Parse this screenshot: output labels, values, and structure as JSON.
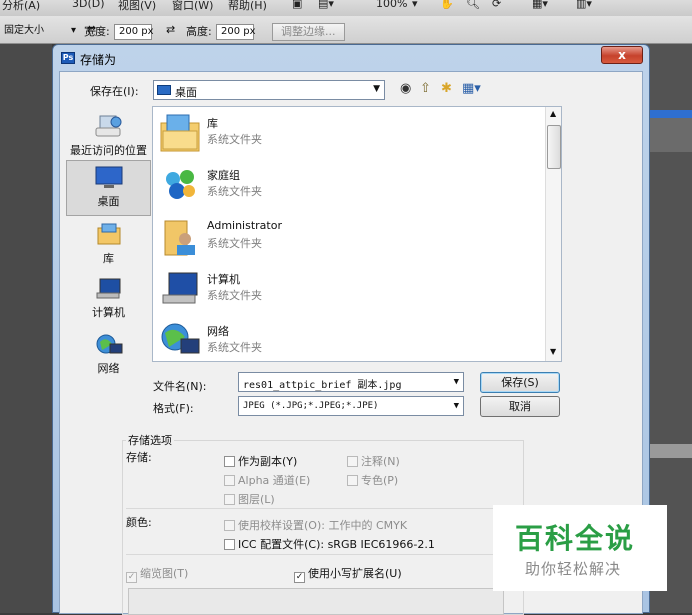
{
  "app": {
    "menus": [
      "分析(A)",
      "3D(D)",
      "视图(V)",
      "窗口(W)",
      "帮助(H)"
    ],
    "zoom": "100%",
    "options": {
      "style_value": "固定大小",
      "width_label": "宽度:",
      "width_value": "200 px",
      "height_label": "高度:",
      "height_value": "200 px",
      "refine_edge_button": "调整边缘..."
    }
  },
  "dialog": {
    "title": "存储为",
    "app_icon": "Ps",
    "close_glyph": "x",
    "save_in_label": "保存在(I):",
    "save_in_value": "桌面",
    "places": [
      {
        "label": "最近访问的位置",
        "icon": "recent-places-icon"
      },
      {
        "label": "桌面",
        "icon": "desktop-icon",
        "selected": true
      },
      {
        "label": "库",
        "icon": "libraries-icon"
      },
      {
        "label": "计算机",
        "icon": "computer-icon"
      },
      {
        "label": "网络",
        "icon": "network-icon"
      }
    ],
    "files": [
      {
        "name": "库",
        "type": "系统文件夹",
        "icon": "libraries-folder-icon"
      },
      {
        "name": "家庭组",
        "type": "系统文件夹",
        "icon": "homegroup-icon"
      },
      {
        "name": "Administrator",
        "type": "系统文件夹",
        "icon": "user-folder-icon"
      },
      {
        "name": "计算机",
        "type": "系统文件夹",
        "icon": "computer-icon"
      },
      {
        "name": "网络",
        "type": "系统文件夹",
        "icon": "network-icon"
      }
    ],
    "filename_label": "文件名(N):",
    "filename_value": "res01_attpic_brief 副本.jpg",
    "format_label": "格式(F):",
    "format_value": "JPEG (*.JPG;*.JPEG;*.JPE)",
    "save_button": "保存(S)",
    "cancel_button": "取消",
    "save_options_title": "存储选项",
    "storage_label": "存储:",
    "as_copy": {
      "label": "作为副本(Y)",
      "checked": false,
      "enabled": true
    },
    "notes": {
      "label": "注释(N)",
      "checked": false,
      "enabled": false
    },
    "alpha": {
      "label": "Alpha 通道(E)",
      "checked": false,
      "enabled": false
    },
    "spot": {
      "label": "专色(P)",
      "checked": false,
      "enabled": false
    },
    "layers": {
      "label": "图层(L)",
      "checked": false,
      "enabled": false
    },
    "color_label": "颜色:",
    "proof": {
      "label": "使用校样设置(O):  工作中的 CMYK",
      "checked": false,
      "enabled": false
    },
    "icc": {
      "label": "ICC 配置文件(C):  sRGB IEC61966-2.1",
      "checked": false,
      "enabled": true
    },
    "thumbnail": {
      "label": "缩览图(T)",
      "checked": true,
      "enabled": false
    },
    "lowercase_ext": {
      "label": "使用小写扩展名(U)",
      "checked": true,
      "enabled": true
    }
  },
  "watermark": {
    "title": "百科全说",
    "subtitle": "助你轻松解决",
    "color": "#2a9e45"
  }
}
